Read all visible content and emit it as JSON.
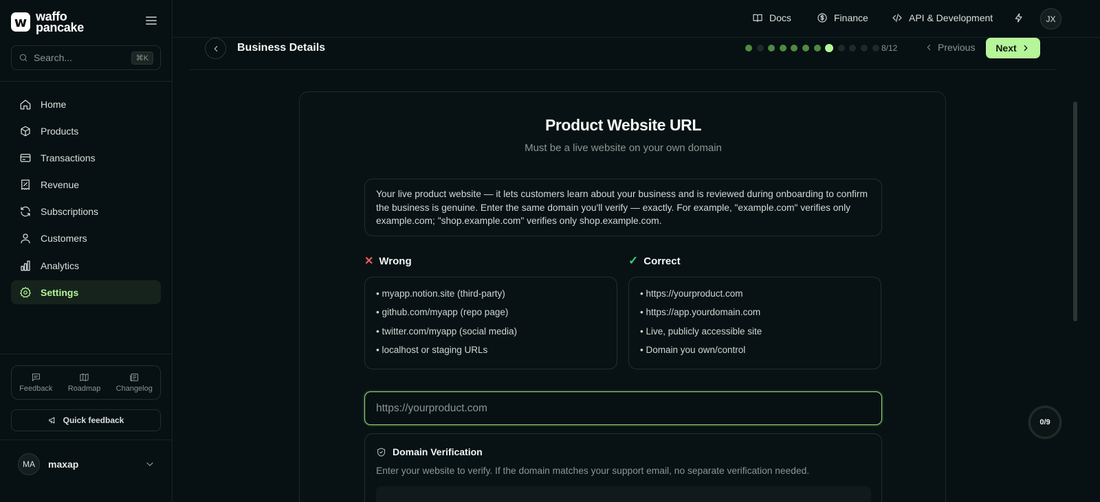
{
  "brand": {
    "line1": "waffo",
    "line2": "pancake",
    "mark": "w"
  },
  "search": {
    "placeholder": "Search...",
    "shortcut": "⌘K"
  },
  "sidebar": {
    "items": [
      {
        "label": "Home",
        "icon": "home-icon"
      },
      {
        "label": "Products",
        "icon": "box-icon"
      },
      {
        "label": "Transactions",
        "icon": "credit-card-icon"
      },
      {
        "label": "Revenue",
        "icon": "receipt-icon"
      },
      {
        "label": "Subscriptions",
        "icon": "refresh-icon"
      },
      {
        "label": "Customers",
        "icon": "user-icon"
      },
      {
        "label": "Analytics",
        "icon": "bar-chart-icon"
      },
      {
        "label": "Settings",
        "icon": "gear-icon",
        "active": true
      }
    ],
    "tools": [
      {
        "label": "Feedback",
        "icon": "message-icon"
      },
      {
        "label": "Roadmap",
        "icon": "map-icon"
      },
      {
        "label": "Changelog",
        "icon": "newspaper-icon"
      }
    ],
    "quick_feedback": "Quick feedback",
    "user": {
      "initials": "MA",
      "name": "maxap"
    }
  },
  "topbar": {
    "links": [
      {
        "label": "Docs",
        "icon": "book-icon"
      },
      {
        "label": "Finance",
        "icon": "dollar-circle-icon"
      },
      {
        "label": "API & Development",
        "icon": "code-icon"
      }
    ],
    "avatar": "JX"
  },
  "step": {
    "title": "Business Details",
    "current": 8,
    "total": 12,
    "counter": "8/12",
    "previous_label": "Previous",
    "next_label": "Next"
  },
  "card": {
    "title": "Product Website URL",
    "subtitle": "Must be a live website on your own domain",
    "info": "Your live product website — it lets customers learn about your business and is reviewed during onboarding to confirm the business is genuine. Enter the same domain you'll verify — exactly. For example, \"example.com\" verifies only example.com; \"shop.example.com\" verifies only shop.example.com.",
    "wrong": {
      "heading": "Wrong",
      "items": [
        "myapp.notion.site (third-party)",
        "github.com/myapp (repo page)",
        "twitter.com/myapp (social media)",
        "localhost or staging URLs"
      ]
    },
    "correct": {
      "heading": "Correct",
      "items": [
        "https://yourproduct.com",
        "https://app.yourdomain.com",
        "Live, publicly accessible site",
        "Domain you own/control"
      ]
    },
    "input": {
      "placeholder": "https://yourproduct.com",
      "value": ""
    },
    "verification": {
      "heading": "Domain Verification",
      "text": "Enter your website to verify. If the domain matches your support email, no separate verification needed."
    }
  },
  "progress_ring": "0/9",
  "colors": {
    "accent": "#b6f59a",
    "background": "#071012",
    "wrong": "#f05a5a",
    "correct": "#3fcf6a"
  }
}
